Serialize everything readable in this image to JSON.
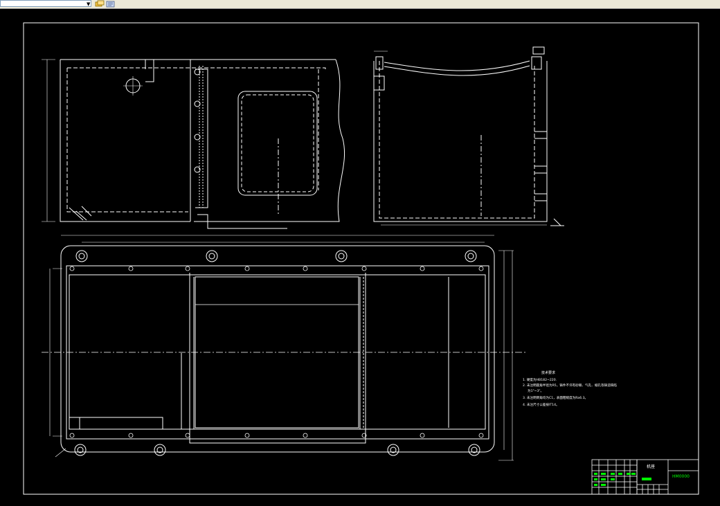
{
  "toolbar": {
    "combo_value": "",
    "combo_arrow_icon": "dropdown-arrow-icon",
    "buttons": [
      {
        "icon": "layer-properties-icon"
      },
      {
        "icon": "layer-state-icon"
      }
    ]
  },
  "drawing": {
    "background_color": "#000000",
    "line_color": "#ffffff",
    "accent_color": "#00ff00",
    "tech_notes": {
      "title": "技术要求",
      "lines": [
        "1. 硬度为HB182~220.",
        "2. 未注明圆角半径为R5，铸件不许有砂眼、气孔、缩孔等铸造缺陷",
        "为1\"~3\"。",
        "3. 未注明倒角均为C1，表面粗糙度为Ra6.3。",
        "4. 未注尺寸公差按IT14。"
      ]
    },
    "title_block": {
      "part_name": "机座",
      "code": "HM0000"
    }
  }
}
